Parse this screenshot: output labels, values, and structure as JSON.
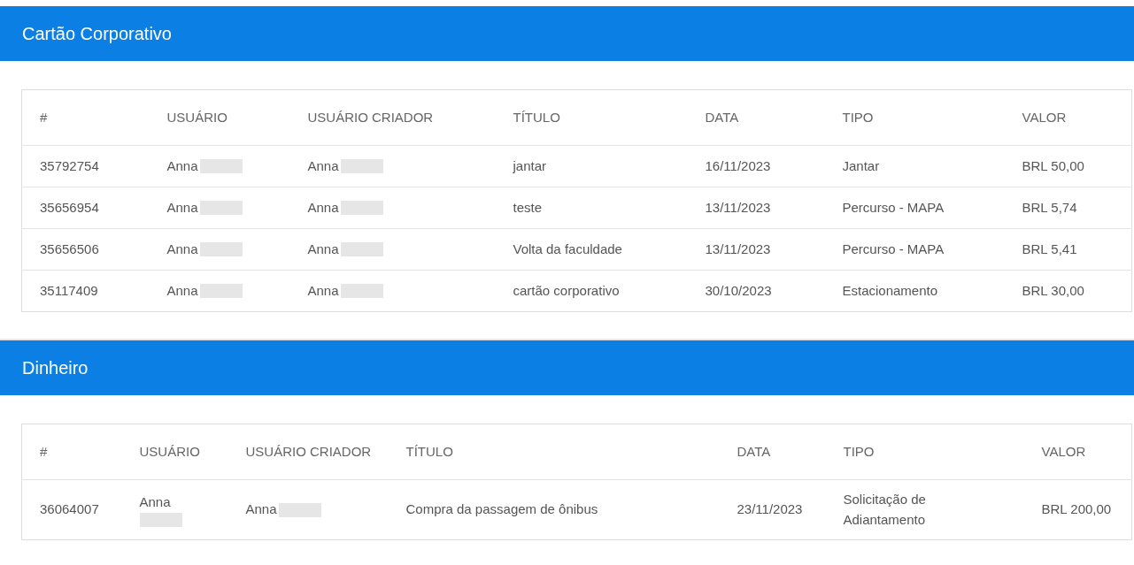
{
  "sections": [
    {
      "title": "Cartão Corporativo",
      "columns": [
        "#",
        "USUÁRIO",
        "USUÁRIO CRIADOR",
        "TÍTULO",
        "DATA",
        "TIPO",
        "VALOR"
      ],
      "rows": [
        {
          "id": "35792754",
          "user": "Anna",
          "creator": "Anna",
          "title": "jantar",
          "date": "16/11/2023",
          "type": "Jantar",
          "value": "BRL 50,00"
        },
        {
          "id": "35656954",
          "user": "Anna",
          "creator": "Anna",
          "title": "teste",
          "date": "13/11/2023",
          "type": "Percurso - MAPA",
          "value": "BRL 5,74"
        },
        {
          "id": "35656506",
          "user": "Anna",
          "creator": "Anna",
          "title": "Volta da faculdade",
          "date": "13/11/2023",
          "type": "Percurso - MAPA",
          "value": "BRL 5,41"
        },
        {
          "id": "35117409",
          "user": "Anna",
          "creator": "Anna",
          "title": "cartão corporativo",
          "date": "30/10/2023",
          "type": "Estacionamento",
          "value": "BRL 30,00"
        }
      ]
    },
    {
      "title": "Dinheiro",
      "columns": [
        "#",
        "USUÁRIO",
        "USUÁRIO CRIADOR",
        "TÍTULO",
        "DATA",
        "TIPO",
        "VALOR"
      ],
      "rows": [
        {
          "id": "36064007",
          "user": "Anna",
          "creator": "Anna",
          "title": "Compra da passagem de ônibus",
          "date": "23/11/2023",
          "type": "Solicitação de Adiantamento",
          "value": "BRL 200,00"
        }
      ]
    }
  ]
}
